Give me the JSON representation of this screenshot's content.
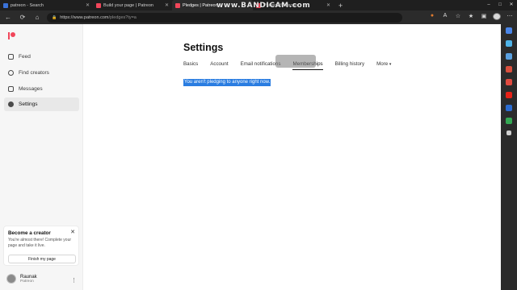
{
  "browser": {
    "tabs": [
      {
        "label": "patreon - Search",
        "color": "#3a72d8"
      },
      {
        "label": "Build your page | Patreon",
        "color": "#f1465a"
      },
      {
        "label": "Pledges | Patreon",
        "color": "#f1465a"
      },
      {
        "label": "Patreon Subscrip",
        "color": "#f1465a"
      }
    ],
    "new_tab": "+",
    "url_host": "https://www.patreon.com",
    "url_path": "/pledges?ty=a",
    "watermark": "www.BANDICAM.com",
    "win": {
      "minimize": "–",
      "maximize": "□",
      "close": "✕"
    },
    "nav": {
      "back": "←",
      "reload": "⟳",
      "home": "⌂"
    },
    "toolbar_icons": [
      "extension-icon",
      "read-aloud-icon",
      "favorite-icon",
      "favorites-bar-icon",
      "collections-icon",
      "profile-icon",
      "menu-icon"
    ]
  },
  "edge_sidebar": {
    "icons": [
      {
        "name": "search-icon",
        "color": "#4a86e8"
      },
      {
        "name": "tag-icon",
        "color": "#4fb3e8"
      },
      {
        "name": "briefcase-icon",
        "color": "#5aa0e0"
      },
      {
        "name": "office-icon",
        "color": "#d94f3d"
      },
      {
        "name": "gmail-icon",
        "color": "#e04a3f"
      },
      {
        "name": "youtube-icon",
        "color": "#e62117"
      },
      {
        "name": "outlook-icon",
        "color": "#2b6cd1"
      },
      {
        "name": "drive-icon",
        "color": "#34a853"
      },
      {
        "name": "add-icon",
        "color": "#cfcfcf"
      }
    ]
  },
  "sidebar": {
    "items": [
      {
        "label": "Feed"
      },
      {
        "label": "Find creators"
      },
      {
        "label": "Messages"
      },
      {
        "label": "Settings"
      }
    ],
    "creator_card": {
      "title": "Become a creator",
      "text": "You're almost there! Complete your page and take it live.",
      "button": "Finish my page",
      "close": "✕"
    },
    "user": {
      "name": "Raunak",
      "subtitle": "Patreon",
      "menu": "⋮"
    }
  },
  "main": {
    "title": "Settings",
    "tabs": [
      {
        "label": "Basics"
      },
      {
        "label": "Account"
      },
      {
        "label": "Email notifications"
      },
      {
        "label": "Memberships"
      },
      {
        "label": "Billing history"
      },
      {
        "label": "More"
      }
    ],
    "more_arrow": "▾",
    "message": "You aren't pledging to anyone right now."
  },
  "colors": {
    "brand": "#f1465a",
    "selection": "#2a7de1"
  }
}
